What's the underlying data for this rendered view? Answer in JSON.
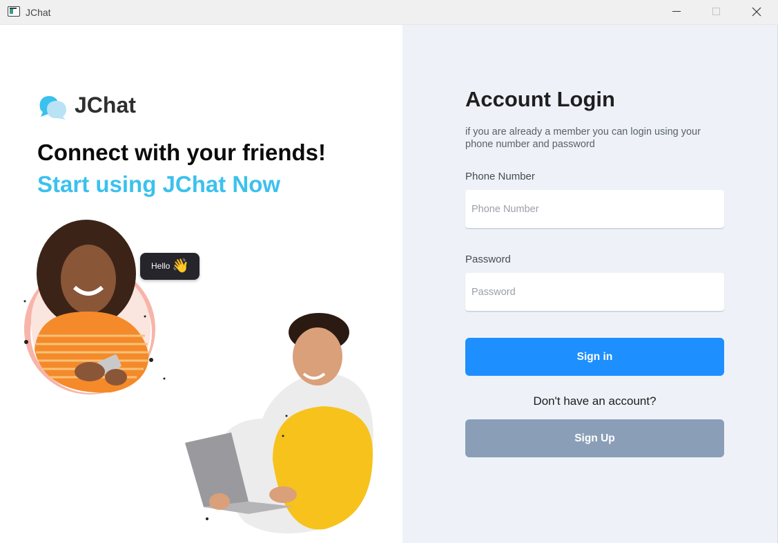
{
  "window": {
    "title": "JChat",
    "icon": "app-window-icon",
    "controls": [
      "minimize-icon",
      "maximize-icon",
      "close-icon"
    ]
  },
  "brand": {
    "logo_icon": "chat-bubbles-icon",
    "name": "JChat"
  },
  "hero": {
    "headline": "Connect with your friends!",
    "subheadline": "Start using JChat Now",
    "bubble_text": "Hello",
    "bubble_emoji": "👋",
    "bubble_icon": "waving-hand-icon"
  },
  "login": {
    "title": "Account Login",
    "description": "if you are already a member you can login using your phone number and password",
    "phone_label": "Phone Number",
    "phone_placeholder": "Phone Number",
    "phone_value": "",
    "password_label": "Password",
    "password_placeholder": "Password",
    "password_value": "",
    "signin_label": "Sign in",
    "no_account_text": "Don't have an account?",
    "signup_label": "Sign Up"
  },
  "colors": {
    "accent_blue": "#1e8ffe",
    "headline_cyan": "#3bc1ee",
    "signup_gray": "#8a9fb7",
    "right_panel_bg": "#eef2f8"
  }
}
